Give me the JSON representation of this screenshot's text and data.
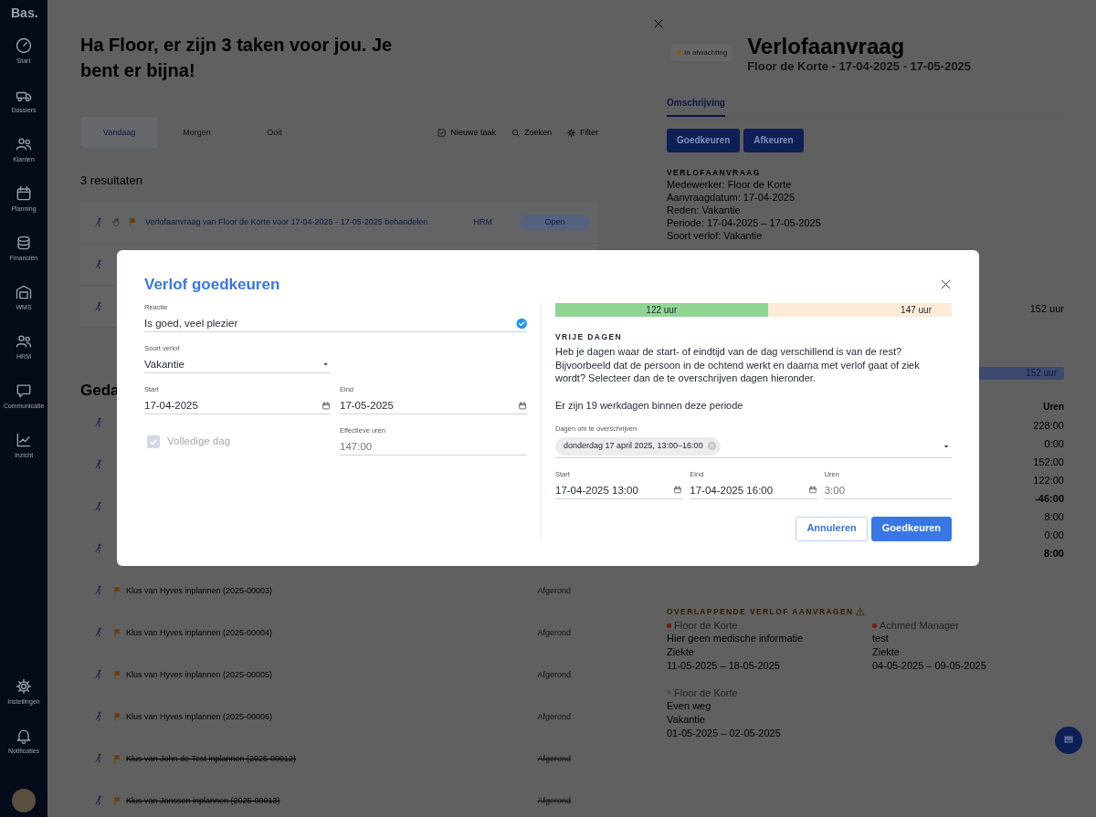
{
  "sidebar": {
    "logo": "Bas.",
    "items": [
      {
        "label": "Start"
      },
      {
        "label": "Dossiers"
      },
      {
        "label": "Klanten"
      },
      {
        "label": "Planning"
      },
      {
        "label": "Financiën"
      },
      {
        "label": "WMS"
      },
      {
        "label": "HRM"
      },
      {
        "label": "Communicatie"
      },
      {
        "label": "Inzicht"
      }
    ],
    "bottom_items": [
      {
        "label": "Instellingen"
      },
      {
        "label": "Notificaties"
      }
    ]
  },
  "main": {
    "heading": "Ha Floor, er zijn 3 taken voor jou. Je bent er bijna!",
    "tabs": [
      {
        "label": "Vandaag",
        "selected": true
      },
      {
        "label": "Morgen",
        "selected": false
      },
      {
        "label": "Ooit",
        "selected": false
      }
    ],
    "actions": [
      "Nieuwe taak",
      "Zoeken",
      "Filter"
    ],
    "results_count": "3 resultaten",
    "open_tasks": [
      {
        "kind": "full",
        "title": "Verlofaanvraag van Floor de Korte voor 17-04-2025 - 17-05-2025 behandelen",
        "category": "HRM",
        "status": "Open"
      },
      {
        "kind": "covered"
      },
      {
        "kind": "covered"
      }
    ],
    "done_heading": "Geda",
    "done_tasks": [
      {
        "kind": "covered"
      },
      {
        "kind": "covered"
      },
      {
        "kind": "covered"
      },
      {
        "kind": "covered"
      },
      {
        "kind": "full",
        "title": "Klus van Hyves inplannen (2025-00003)",
        "status": "Afgerond",
        "struck": false
      },
      {
        "kind": "full",
        "title": "Klus van Hyves inplannen (2025-00004)",
        "status": "Afgerond",
        "struck": false
      },
      {
        "kind": "full",
        "title": "Klus van Hyves inplannen (2025-00005)",
        "status": "Afgerond",
        "struck": false
      },
      {
        "kind": "full",
        "title": "Klus van Hyves inplannen (2025-00006)",
        "status": "Afgerond",
        "struck": false
      },
      {
        "kind": "full",
        "title": "Klus van John de Test inplannen (2025-00012)",
        "status": "Afgerond",
        "struck": true
      },
      {
        "kind": "full",
        "title": "Klus van Janssen inplannen (2025-00013)",
        "status": "Afgerond",
        "struck": true
      }
    ]
  },
  "detail_panel": {
    "status_badge": {
      "label": "In afwachting",
      "color": "#8a5a10"
    },
    "title": "Verlofaanvraag",
    "subtitle": "Floor de Korte - 17-04-2025 - 17-05-2025",
    "tabs": [
      {
        "label": "Omschrijving",
        "selected": true
      }
    ],
    "buttons": [
      "Goedkeuren",
      "Afkeuren"
    ],
    "details": {
      "heading": "VERLOFAANVRAAG",
      "lines": [
        "Medewerker: Floor de Korte",
        "Aanvraagdatum: 17-04-2025",
        "Reden: Vakantie",
        "Periode: 17-04-2025 – 17-05-2025",
        "Soort verlof: Vakantie"
      ]
    },
    "balance": {
      "total": "152 uur",
      "bar_label": "152 uur"
    },
    "hours_table": {
      "header": "Uren",
      "values": [
        {
          "value": "228:00",
          "bold": false
        },
        {
          "value": "0:00",
          "bold": false
        },
        {
          "value": "152:00",
          "bold": false
        },
        {
          "value": "122:00",
          "bold": false
        },
        {
          "value": "-46:00",
          "bold": true
        },
        {
          "value": "8:00",
          "bold": false
        },
        {
          "value": "0:00",
          "bold": false
        },
        {
          "value": "8:00",
          "bold": true
        }
      ]
    },
    "overlapping": {
      "heading": "OVERLAPPENDE VERLOF AANVRAGEN",
      "requests": [
        {
          "name": "Floor de Korte",
          "color": "#7a1414",
          "note": "Hier geen medische informatie",
          "type": "Ziekte",
          "period": "11-05-2025 – 18-05-2025"
        },
        {
          "name": "Achmed Manager",
          "color": "#8a1010",
          "note": "test",
          "type": "Ziekte",
          "period": "04-05-2025 – 09-05-2025"
        },
        {
          "name": "Floor de Korte",
          "color": "#505050",
          "note": "Even weg",
          "type": "Vakantie",
          "period": "01-05-2025 – 02-05-2025"
        }
      ]
    }
  },
  "modal": {
    "title": "Verlof goedkeuren",
    "reaction": {
      "label": "Reactie",
      "value": "Is goed, veel plezier",
      "valid": true
    },
    "leave_type": {
      "label": "Soort verlof",
      "value": "Vakantie"
    },
    "start": {
      "label": "Start",
      "value": "17-04-2025"
    },
    "end": {
      "label": "Eind",
      "value": "17-05-2025"
    },
    "full_day": {
      "label": "Volledige dag",
      "checked": true,
      "disabled": true
    },
    "effective_hours": {
      "label": "Effectieve uren",
      "value": "147:00",
      "readonly": true
    },
    "hours_bar": {
      "level": 0.536,
      "used_label": "122 uur",
      "total_label": "147 uur"
    },
    "free_days": {
      "heading": "VRIJE DAGEN",
      "text": "Heb je dagen waar de start- of eindtijd van de dag verschillend is van de rest? Bijvoorbeeld dat de persoon in de ochtend werkt en daarna met verlof gaat of ziek wordt? Selecteer dan de te overschrijven dagen hieronder.",
      "workdays_note": "Er zijn 19 werkdagen binnen deze periode"
    },
    "override": {
      "label": "Dagen om te overschrijven",
      "chips": [
        "donderdag 17 april 2025, 13:00–16:00"
      ]
    },
    "override_start": {
      "label": "Start",
      "value": "17-04-2025 13:00"
    },
    "override_end": {
      "label": "Eind",
      "value": "17-04-2025 16:00"
    },
    "override_hours": {
      "label": "Uren",
      "value": "3:00",
      "readonly": true
    },
    "buttons": [
      {
        "label": "Annuleren",
        "kind": "secondary"
      },
      {
        "label": "Goedkeuren",
        "kind": "primary"
      }
    ]
  }
}
